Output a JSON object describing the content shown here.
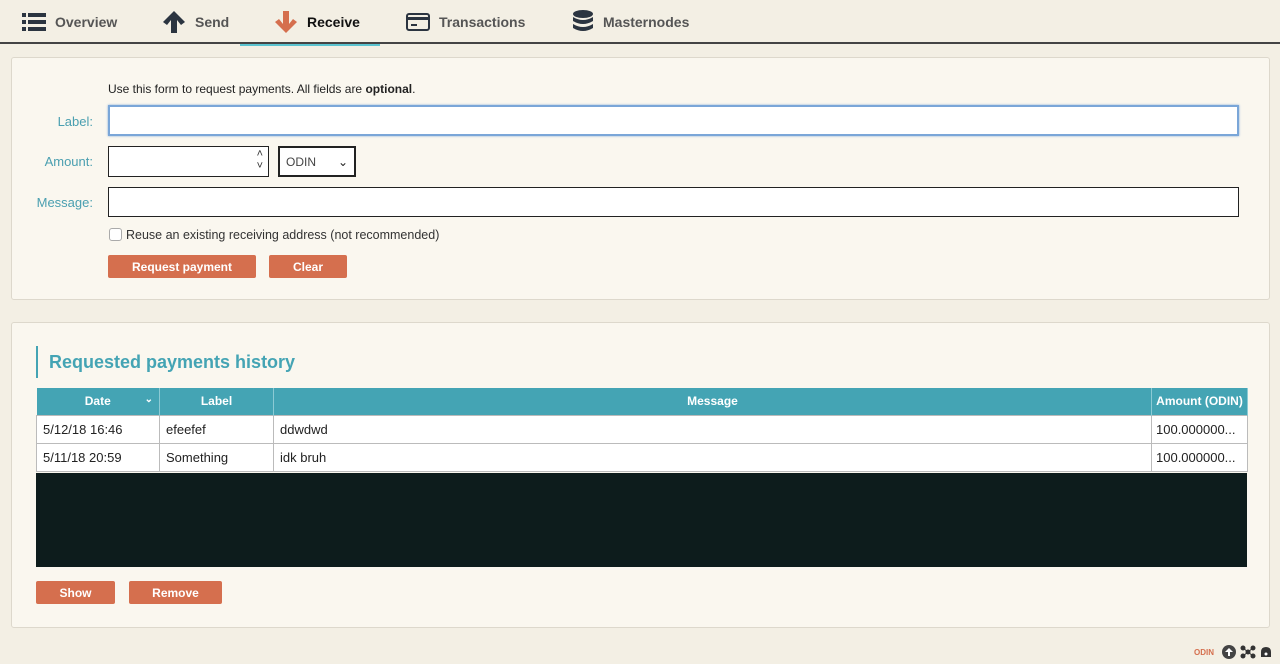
{
  "nav": {
    "tabs": [
      {
        "label": "Overview",
        "icon": "list-icon"
      },
      {
        "label": "Send",
        "icon": "arrow-up-icon"
      },
      {
        "label": "Receive",
        "icon": "arrow-down-icon",
        "active": true
      },
      {
        "label": "Transactions",
        "icon": "card-icon"
      },
      {
        "label": "Masternodes",
        "icon": "database-icon"
      }
    ]
  },
  "form": {
    "intro": "Use this form to request payments. All fields are ",
    "intro_bold": "optional",
    "intro_end": ".",
    "label_label": "Label:",
    "amount_label": "Amount:",
    "message_label": "Message:",
    "unit": "ODIN",
    "reuse": "Reuse an existing receiving address (not recommended)",
    "request_button": "Request payment",
    "clear_button": "Clear"
  },
  "history": {
    "title": "Requested payments history",
    "columns": [
      "Date",
      "Label",
      "Message",
      "Amount (ODIN)"
    ],
    "rows": [
      [
        "5/12/18 16:46",
        "efeefef",
        "ddwdwd",
        "100.000000..."
      ],
      [
        "5/11/18 20:59",
        "Something",
        "idk bruh",
        "100.000000..."
      ]
    ],
    "show_button": "Show",
    "remove_button": "Remove"
  },
  "status": {
    "unit": "ODIN"
  },
  "colors": {
    "accent": "#d56f4e",
    "teal": "#44a4b4"
  }
}
